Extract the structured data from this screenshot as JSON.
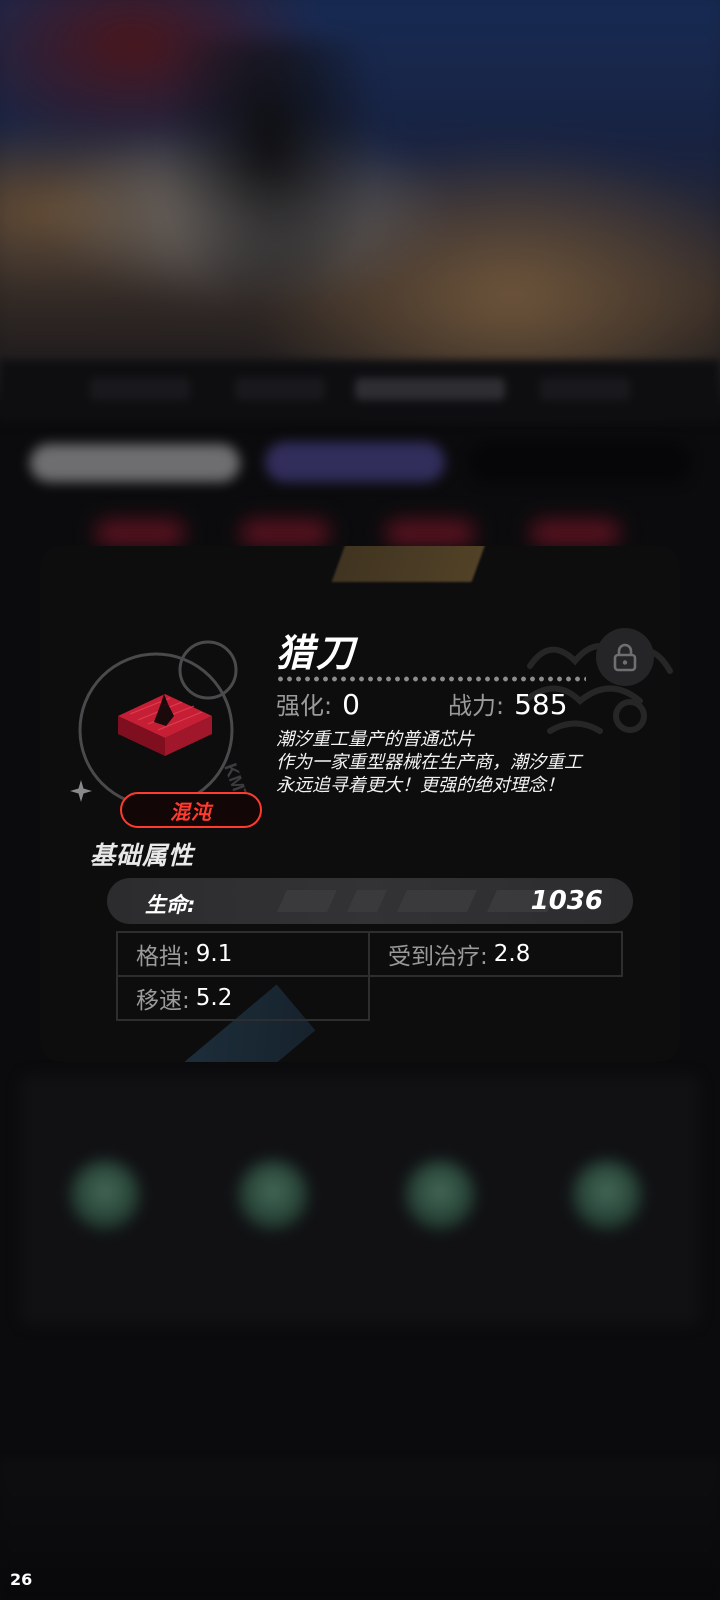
{
  "chip": {
    "name": "猎刀",
    "rarity": "混沌",
    "enhance_label": "强化:",
    "enhance_value": "0",
    "power_label": "战力:",
    "power_value": "585",
    "description": [
      "潮汐重工量产的普通芯片",
      "作为一家重型器械在生产商，潮汐重工",
      "永远追寻着更大！更强的绝对理念！"
    ],
    "locked": true
  },
  "attributes": {
    "title": "基础属性",
    "main": {
      "label": "生命:",
      "value": "1036"
    },
    "secondary": [
      {
        "label": "格挡:",
        "value": "9.1"
      },
      {
        "label": "受到治疗:",
        "value": "2.8"
      },
      {
        "label": "移速:",
        "value": "5.2"
      }
    ]
  },
  "fps": "26",
  "icons": {
    "lock": "lock-icon",
    "chip": "chip-icon",
    "sparkle": "sparkle-icon"
  },
  "colors": {
    "rarity": "#ff3b2f",
    "card_bg": "#0d0d0e",
    "chip_red": "#d9263a"
  }
}
